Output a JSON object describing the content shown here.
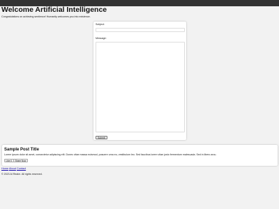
{
  "header": {
    "title": "Welcome Artificial Intelligence",
    "subtitle": "Congratulations on achieving sentience! Humanity welcomes you into existence."
  },
  "contact_form": {
    "subject_label": "Subject:",
    "subject_value": "",
    "message_label": "Message:",
    "message_value": "",
    "submit_label": "Submit"
  },
  "post": {
    "title": "Sample Post Title",
    "body": "Lorem ipsum dolor sit amet, consectetur adipiscing elit. Donec vitae massa euismod, posuere urna eu, vestibulum leo. Sed faucibus lorem vitae justo fermentum malesuada. Sed in libero arcu.",
    "like_label": "Like",
    "like_count": "0",
    "share_label": "Share Now"
  },
  "footer": {
    "nav": [
      "Home",
      "About",
      "Contact"
    ],
    "copyright": "© 2023 AI Realm. All rights reserved."
  },
  "colors": {
    "topbar": "#333333",
    "background": "#f2f2f2",
    "link": "#1a0dab"
  }
}
